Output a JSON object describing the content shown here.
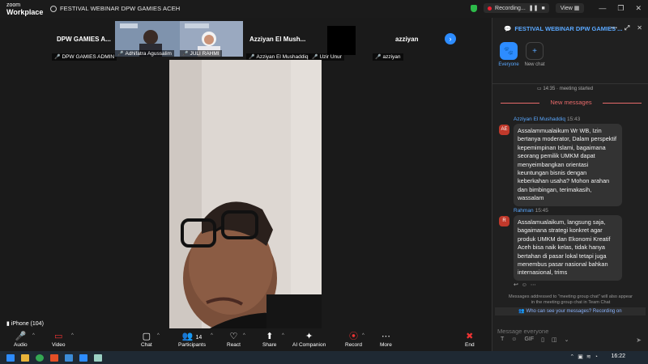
{
  "app": {
    "brand_line1": "zoom",
    "brand_line2": "Workplace",
    "meeting_title": "FESTIVAL WEBINAR DPW GAMIES ACEH"
  },
  "titlebar": {
    "recording_label": "Recording...",
    "view_label": "View"
  },
  "gallery": {
    "tile1_name": "DPW GAMIES A...",
    "tile1_tag": "DPW GAMIES ADMIN",
    "tile2_tag_a": "Adhifatra Agussalim",
    "tile2_tag_b": "JULI RAHMI",
    "tile3_name": "Azziyan El Mush...",
    "tile3_tag": "Azziyan El Mushaddiq",
    "tile4_tag": "Uzir Unur",
    "tile5_name": "azziyan",
    "tile5_tag": "azziyan"
  },
  "speaker": {
    "label": "iPhone (104)"
  },
  "controls": {
    "audio": "Audio",
    "video": "Video",
    "chat": "Chat",
    "participants": "Participants",
    "participants_count": "14",
    "react": "React",
    "share": "Share",
    "ai": "AI Companion",
    "record": "Record",
    "more": "More",
    "end": "End"
  },
  "chat": {
    "title": "FESTIVAL WEBINAR DPW GAMIES ...",
    "tab_everyone": "Everyone",
    "tab_new": "New chat",
    "started": "14:35 · meeting started",
    "new_messages": "New messages",
    "messages": [
      {
        "avatar": "AE",
        "sender": "Azziyan El Mushaddiq",
        "time": "15:43",
        "text": "Assalammualaikum Wr WB, Izin bertanya moderator, Dalam perspektif kepemimpinan Islami, bagaimana seorang pemilik UMKM dapat menyeimbangkan orientasi keuntungan bisnis dengan keberkahan usaha? Mohon arahan dan bimbingan, terimakasih, wassalam"
      },
      {
        "avatar": "R",
        "sender": "Rahman",
        "time": "15:45",
        "text": "Assalamualaikum, langsung saja, bagaimana strategi konkret agar produk UMKM dan Ekonomi Kreatif Aceh bisa naik kelas, tidak hanya bertahan di pasar lokal tetapi juga menembus pasar nasional bahkan internasional, trims"
      }
    ],
    "notice": "Messages addressed to \"meeting group chat\" will also appear in the meeting group chat in Team Chat",
    "who_can_see": "Who can see your messages? Recording on",
    "input_placeholder": "Message everyone"
  },
  "taskbar": {
    "clock": "16:22"
  },
  "colors": {
    "accent": "#2d8cff",
    "alert": "#e86a6a",
    "panel": "#202020"
  }
}
